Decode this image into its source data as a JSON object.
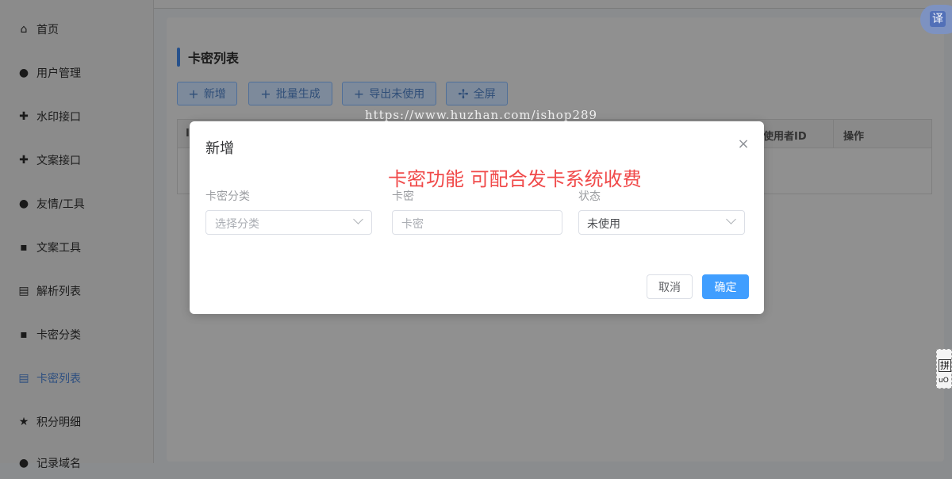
{
  "sidebar": {
    "items": [
      {
        "label": "首页",
        "icon": "home-icon",
        "glyph": "⌂"
      },
      {
        "label": "用户管理",
        "icon": "user-icon",
        "glyph": "●"
      },
      {
        "label": "水印接口",
        "icon": "crosshair-icon",
        "glyph": "✚"
      },
      {
        "label": "文案接口",
        "icon": "crosshair-icon",
        "glyph": "✚"
      },
      {
        "label": "友情/工具",
        "icon": "user-icon",
        "glyph": "●"
      },
      {
        "label": "文案工具",
        "icon": "chat-icon",
        "glyph": "▪"
      },
      {
        "label": "解析列表",
        "icon": "clipboard-icon",
        "glyph": "▤"
      },
      {
        "label": "卡密分类",
        "icon": "chat-icon",
        "glyph": "▪"
      },
      {
        "label": "卡密列表",
        "icon": "clipboard-icon",
        "glyph": "▤",
        "active": true
      },
      {
        "label": "积分明细",
        "icon": "star-icon",
        "glyph": "★"
      },
      {
        "label": "记录域名",
        "icon": "link-icon",
        "glyph": "●"
      }
    ]
  },
  "page": {
    "title": "卡密列表",
    "buttons": {
      "add": "新增",
      "batch": "批量生成",
      "export": "导出未使用",
      "fullscreen": "全屏"
    },
    "table_headers": {
      "first": "I",
      "user_id": "使用者ID",
      "actions": "操作"
    }
  },
  "watermark": "https://www.huzhan.com/ishop289",
  "translate_badge": "译",
  "ime_badge": {
    "top": "拼",
    "bottom": "uO"
  },
  "modal": {
    "title": "新增",
    "promo": "卡密功能 可配合发卡系统收费",
    "fields": {
      "category": {
        "label": "卡密分类",
        "placeholder": "选择分类"
      },
      "code": {
        "label": "卡密",
        "placeholder": "卡密"
      },
      "status": {
        "label": "状态",
        "value": "未使用"
      }
    },
    "cancel": "取消",
    "confirm": "确定"
  },
  "colors": {
    "accent": "#409eff",
    "promo": "#f04a4a",
    "active_menu": "#2d4f80"
  }
}
